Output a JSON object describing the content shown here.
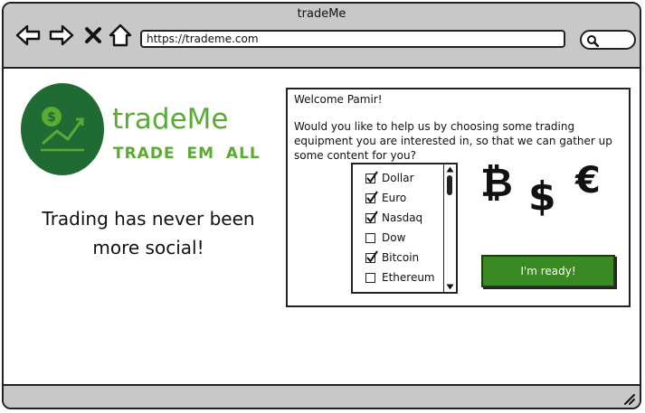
{
  "window": {
    "title": "tradeMe"
  },
  "toolbar": {
    "url": "https://trademe.com"
  },
  "brand": {
    "name": "tradeMe",
    "tagline": "TRADE EM ALL",
    "color": "#5aaa35",
    "logo_bg": "#1f6b33"
  },
  "hero": {
    "headline_line1": "Trading has never been",
    "headline_line2": "more social!"
  },
  "panel": {
    "welcome": "Welcome Pamir!",
    "question": "Would you like to help us by choosing some trading equipment you are interested in, so that we can gather up some content for you?",
    "options": [
      {
        "label": "Dollar",
        "checked": true
      },
      {
        "label": "Euro",
        "checked": true
      },
      {
        "label": "Nasdaq",
        "checked": true
      },
      {
        "label": "Dow",
        "checked": false
      },
      {
        "label": "Bitcoin",
        "checked": true
      },
      {
        "label": "Ethereum",
        "checked": false
      }
    ],
    "currency_symbols": {
      "bitcoin": "₿",
      "dollar": "$",
      "euro": "€"
    },
    "ready_label": "I'm ready!",
    "ready_color": "#3a8a23"
  }
}
